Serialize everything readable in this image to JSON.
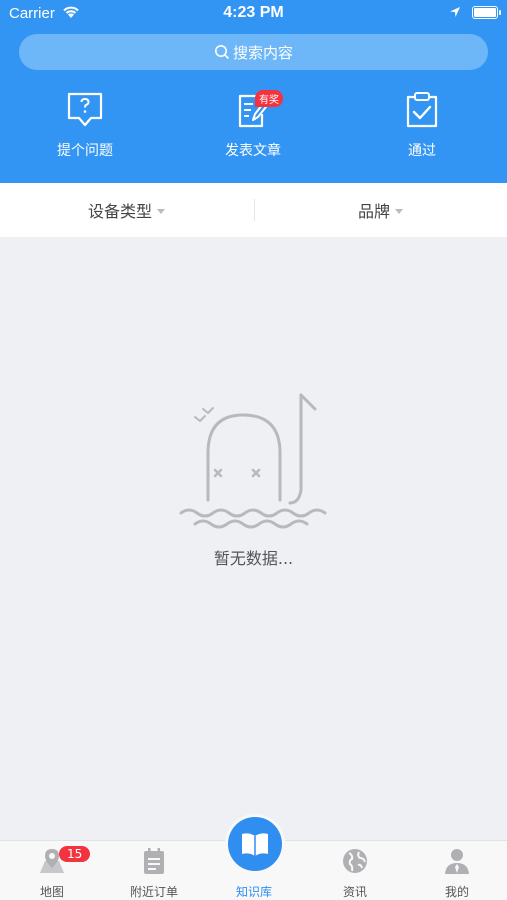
{
  "status_bar": {
    "carrier": "Carrier",
    "time": "4:23 PM"
  },
  "search": {
    "placeholder": "搜索内容",
    "icon": "search-icon"
  },
  "actions": [
    {
      "label": "提个问题",
      "icon": "question-bubble-icon"
    },
    {
      "label": "发表文章",
      "icon": "write-article-icon",
      "badge": "有奖"
    },
    {
      "label": "通过",
      "icon": "clipboard-check-icon"
    }
  ],
  "filters": [
    {
      "label": "设备类型"
    },
    {
      "label": "品牌"
    }
  ],
  "empty": {
    "text": "暂无数据..."
  },
  "tabs": [
    {
      "label": "地图",
      "icon": "map-pin-icon",
      "badge": "15"
    },
    {
      "label": "附近订单",
      "icon": "order-list-icon"
    },
    {
      "label": "知识库",
      "icon": "book-icon",
      "active": true
    },
    {
      "label": "资讯",
      "icon": "globe-icon"
    },
    {
      "label": "我的",
      "icon": "user-icon"
    }
  ],
  "colors": {
    "primary": "#3395f3",
    "badge": "#f3333d",
    "background": "#eff0f4"
  }
}
